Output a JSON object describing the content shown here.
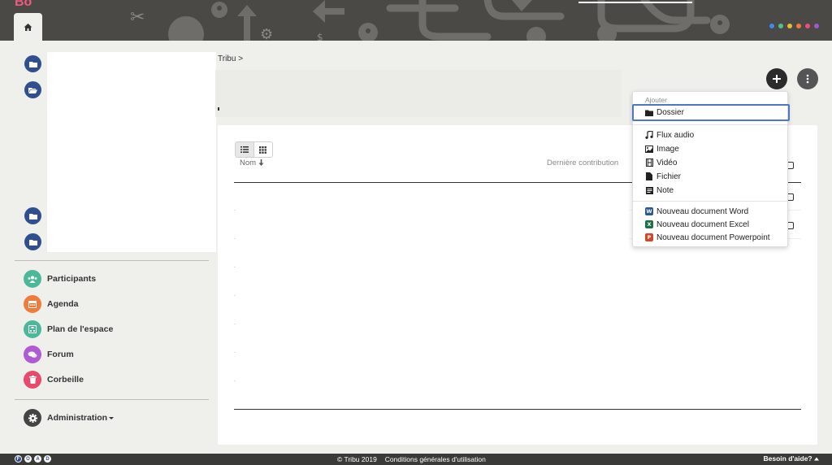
{
  "banner": {
    "logo_fragment": "Bo",
    "accent_dots": [
      "#3b8beb",
      "#4cc38a",
      "#f2b632",
      "#f07b3a",
      "#ee4b84",
      "#9b59d6"
    ]
  },
  "sidebar": {
    "nav": [
      {
        "label": "Participants",
        "icon": "users-icon",
        "color": "#4cb89a"
      },
      {
        "label": "Agenda",
        "icon": "calendar-icon",
        "color": "#f07b3a"
      },
      {
        "label": "Plan de l'espace",
        "icon": "sitemap-icon",
        "color": "#4cb89a"
      },
      {
        "label": "Forum",
        "icon": "chat-icon",
        "color": "#b05ad6"
      },
      {
        "label": "Corbeille",
        "icon": "trash-icon",
        "color": "#e84a6b"
      }
    ],
    "admin": {
      "label": "Administration",
      "icon": "gear-icon",
      "color": "#444"
    }
  },
  "breadcrumb": {
    "text": "Tribu >"
  },
  "table": {
    "columns": {
      "name": "Nom",
      "last": "Dernière contribution"
    }
  },
  "add_menu": {
    "header": "Ajouter",
    "items": [
      {
        "label": "Dossier",
        "icon": "folder-icon"
      },
      {
        "label": "Flux audio",
        "icon": "music-icon"
      },
      {
        "label": "Image",
        "icon": "image-icon"
      },
      {
        "label": "Vidéo",
        "icon": "film-icon"
      },
      {
        "label": "Fichier",
        "icon": "file-icon"
      },
      {
        "label": "Note",
        "icon": "note-icon"
      }
    ],
    "office": [
      {
        "label": "Nouveau document Word",
        "badge": "W",
        "color": "#2b5797"
      },
      {
        "label": "Nouveau document Excel",
        "badge": "X",
        "color": "#1e7145"
      },
      {
        "label": "Nouveau document Powerpoint",
        "badge": "P",
        "color": "#d24726"
      }
    ]
  },
  "footer": {
    "foad": [
      "F",
      "O",
      "A",
      "D"
    ],
    "copyright": "© Tribu 2019",
    "cgu": "Conditions générales d'utilisation",
    "help": "Besoin d'aide?"
  }
}
